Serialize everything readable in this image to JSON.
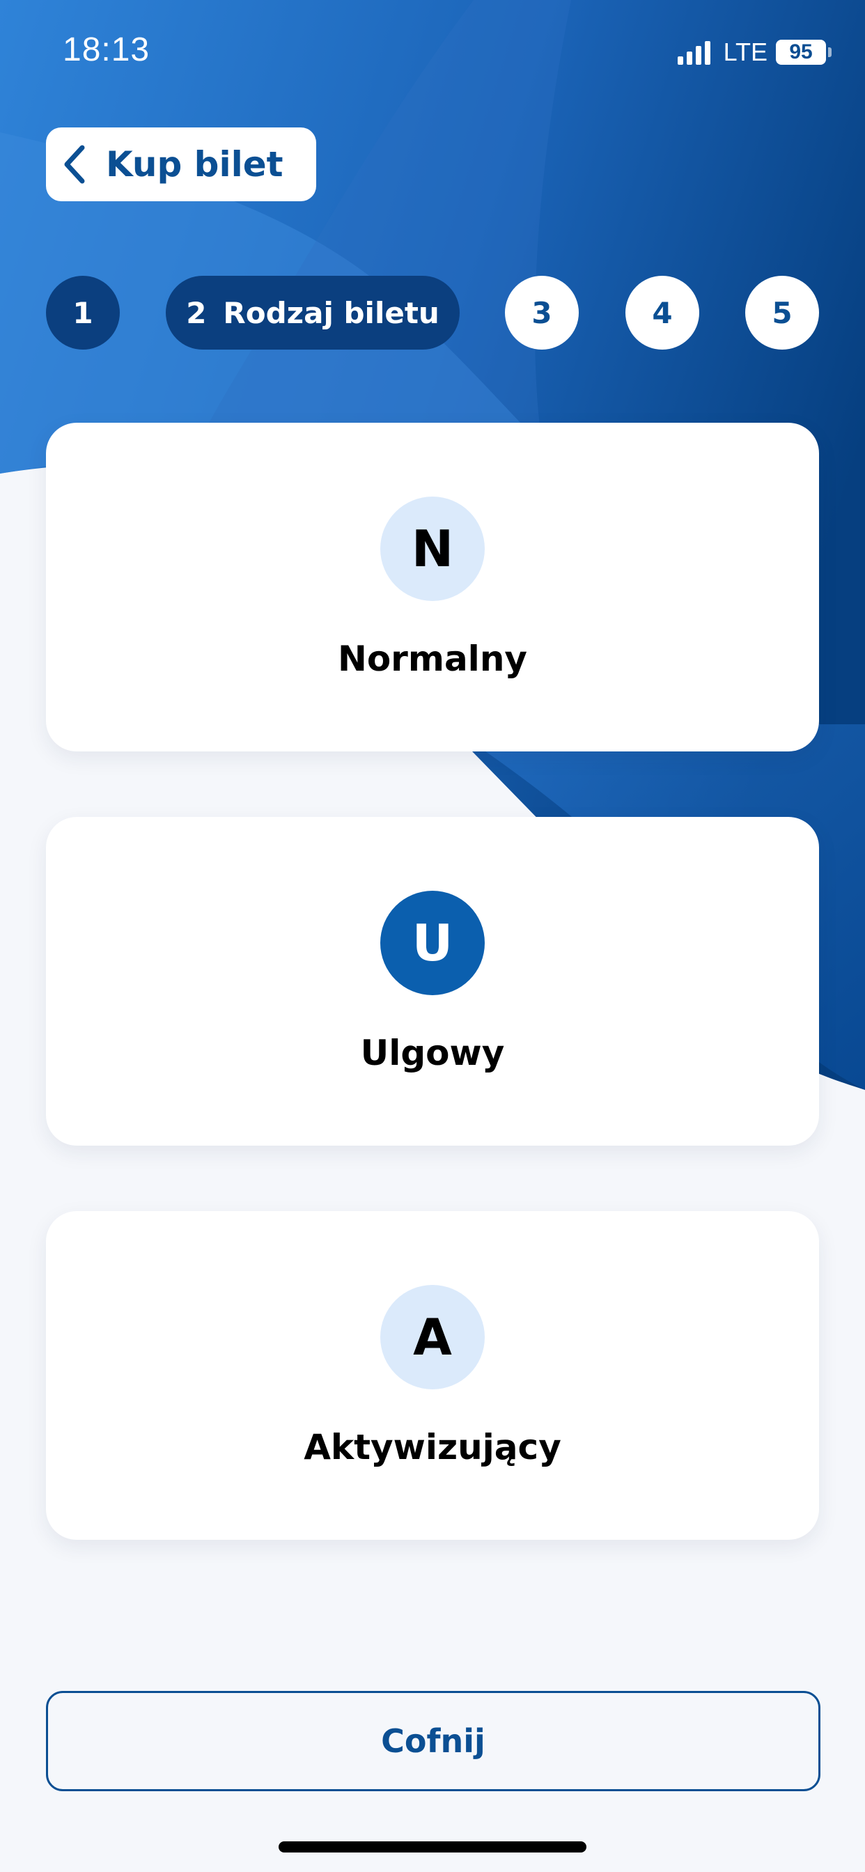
{
  "status_bar": {
    "time": "18:13",
    "network": "LTE",
    "battery": "95",
    "signal_icon": "signal-bars-icon",
    "battery_icon": "battery-icon"
  },
  "header": {
    "back_label": "Kup bilet",
    "back_icon": "chevron-left-icon"
  },
  "stepper": {
    "steps": [
      {
        "number": "1",
        "label": "",
        "state": "done"
      },
      {
        "number": "2",
        "label": "Rodzaj biletu",
        "state": "active"
      },
      {
        "number": "3",
        "label": "",
        "state": "todo"
      },
      {
        "number": "4",
        "label": "",
        "state": "todo"
      },
      {
        "number": "5",
        "label": "",
        "state": "todo"
      }
    ]
  },
  "ticket_types": [
    {
      "letter": "N",
      "label": "Normalny",
      "badge_color": "#dbeafb"
    },
    {
      "letter": "U",
      "label": "Ulgowy",
      "badge_color": "#0b5fae"
    },
    {
      "letter": "A",
      "label": "Aktywizujący",
      "badge_color": "#dbeafb"
    }
  ],
  "footer": {
    "back_button_label": "Cofnij"
  },
  "colors": {
    "brand_dark": "#0b3f7f",
    "brand": "#0b5fae",
    "background": "#f5f7fb"
  }
}
